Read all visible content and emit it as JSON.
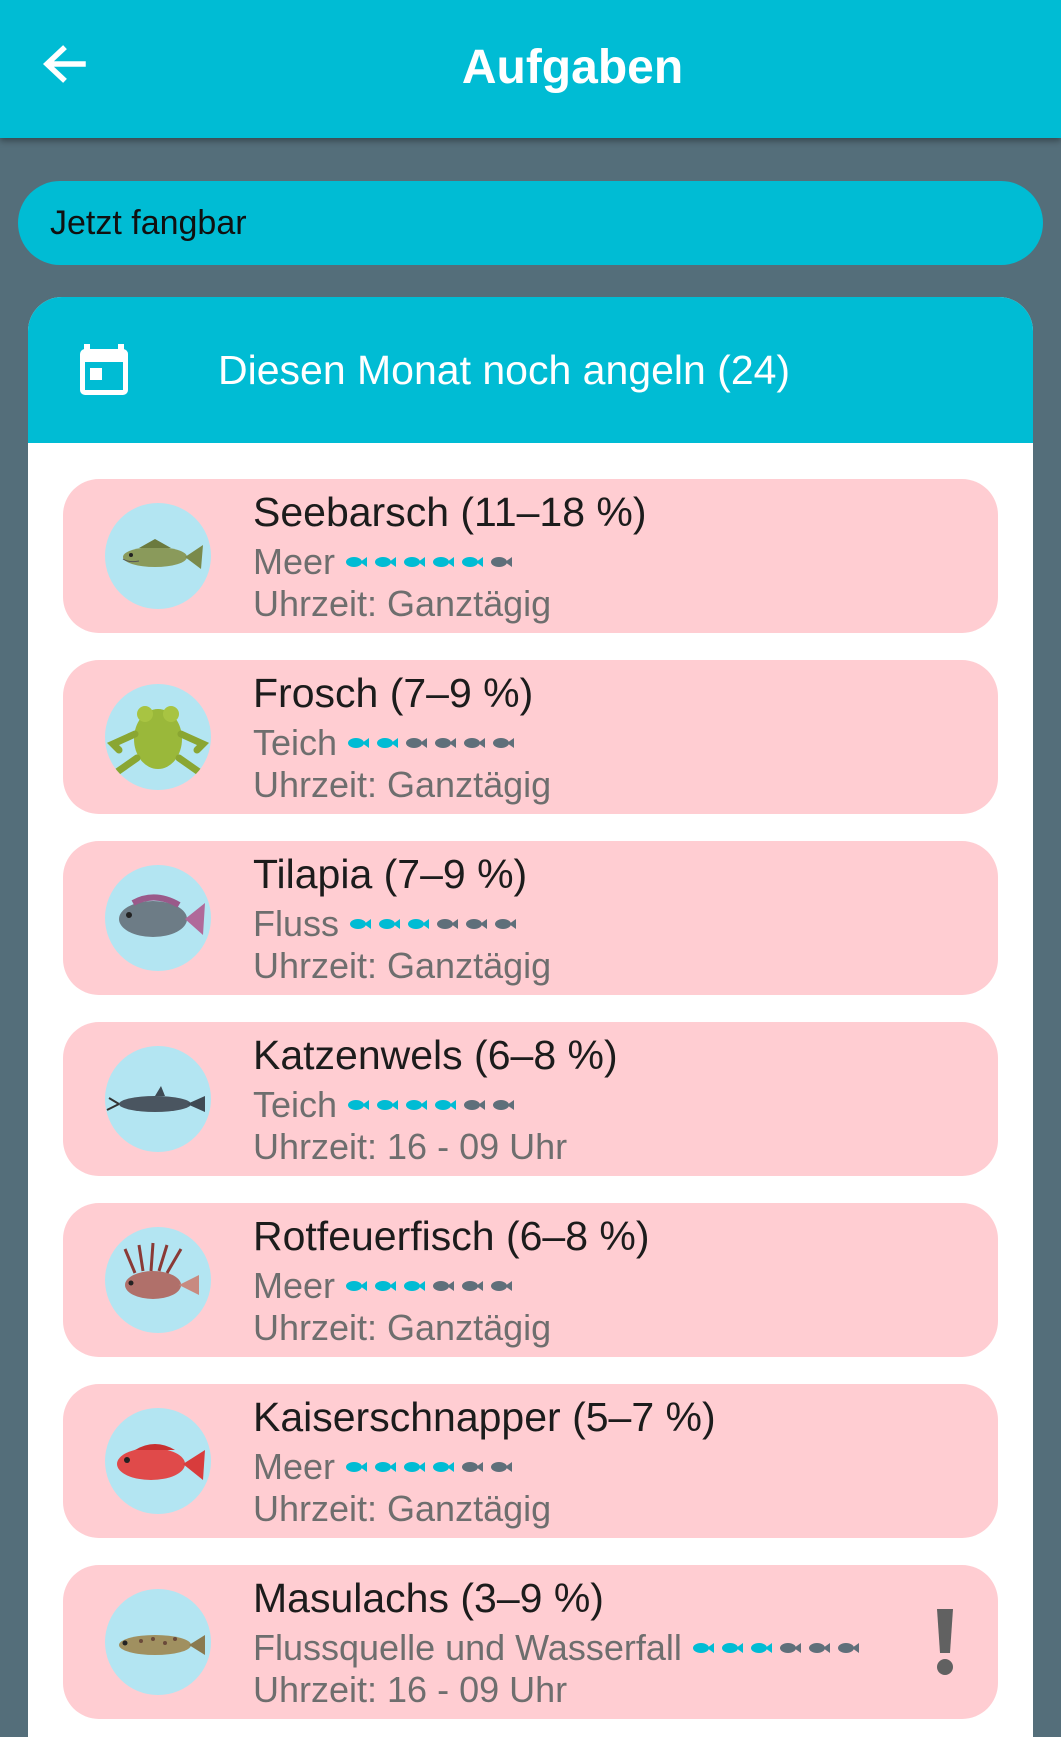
{
  "appbar": {
    "title": "Aufgaben",
    "back_icon": "arrow-left-icon"
  },
  "filter": {
    "label": "Jetzt fangbar"
  },
  "panel": {
    "title": "Diesen Monat noch angeln (24)",
    "icon": "calendar-icon"
  },
  "colors": {
    "primary": "#00bcd4",
    "background": "#546e7a",
    "card": "#ffcdd2",
    "rarity_active": "#00bcd4",
    "rarity_inactive": "#5f6f7a",
    "avatar_bg": "#b3e5f2"
  },
  "items": [
    {
      "title": "Seebarsch (11–18 %)",
      "location": "Meer",
      "time": "Uhrzeit: Ganztägig",
      "rarity": 5,
      "icon": "seebarsch-icon",
      "alert": false
    },
    {
      "title": "Frosch (7–9 %)",
      "location": "Teich",
      "time": "Uhrzeit: Ganztägig",
      "rarity": 2,
      "icon": "frosch-icon",
      "alert": false
    },
    {
      "title": "Tilapia (7–9 %)",
      "location": "Fluss",
      "time": "Uhrzeit: Ganztägig",
      "rarity": 3,
      "icon": "tilapia-icon",
      "alert": false
    },
    {
      "title": "Katzenwels (6–8 %)",
      "location": "Teich",
      "time": "Uhrzeit: 16 - 09 Uhr",
      "rarity": 4,
      "icon": "katzenwels-icon",
      "alert": false
    },
    {
      "title": "Rotfeuerfisch (6–8 %)",
      "location": "Meer",
      "time": "Uhrzeit: Ganztägig",
      "rarity": 3,
      "icon": "rotfeuerfisch-icon",
      "alert": false
    },
    {
      "title": "Kaiserschnapper (5–7 %)",
      "location": "Meer",
      "time": "Uhrzeit: Ganztägig",
      "rarity": 4,
      "icon": "kaiserschnapper-icon",
      "alert": false
    },
    {
      "title": "Masulachs (3–9 %)",
      "location": "Flussquelle und Wasserfall",
      "time": "Uhrzeit: 16 - 09 Uhr",
      "rarity": 3,
      "icon": "masulachs-icon",
      "alert": true
    }
  ]
}
